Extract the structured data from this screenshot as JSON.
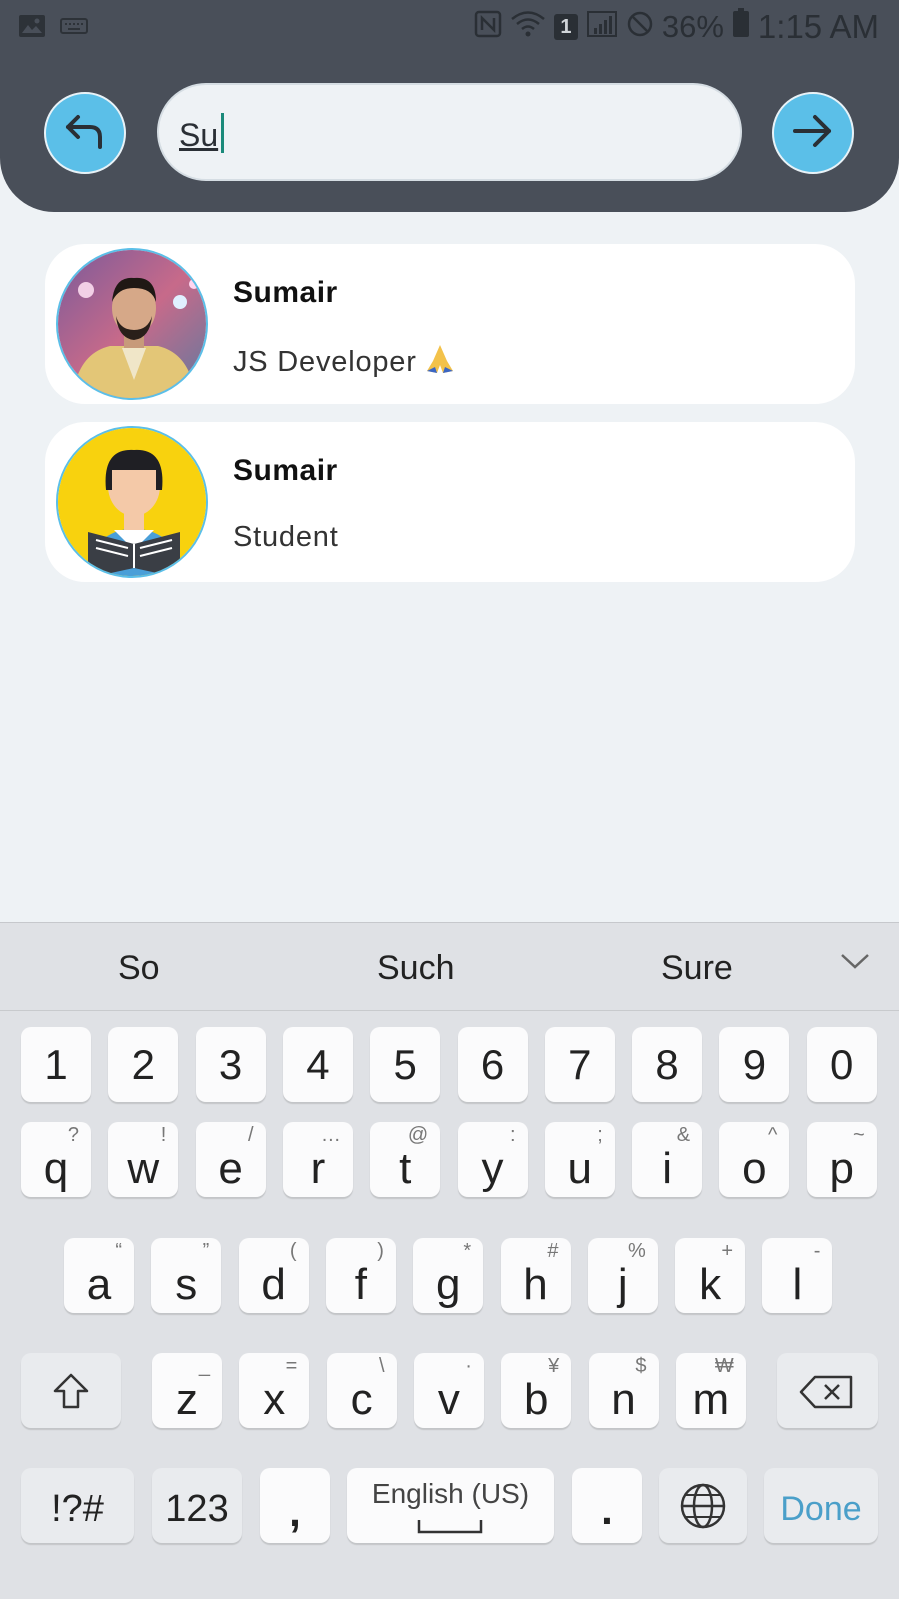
{
  "status_bar": {
    "battery_percent": "36%",
    "time": "1:15 AM",
    "sim_badge": "1",
    "icons": [
      "image-icon",
      "keyboard-icon",
      "nfc-icon",
      "wifi-icon",
      "signal-icon",
      "do-not-disturb-icon",
      "battery-icon"
    ]
  },
  "search": {
    "value": "Su",
    "back_icon": "back-arrow-icon",
    "go_icon": "arrow-right-icon"
  },
  "results": [
    {
      "name": "Sumair",
      "subtitle": "JS Developer",
      "emoji": "folded-hands-emoji",
      "avatar": "photo"
    },
    {
      "name": "Sumair",
      "subtitle": "Student",
      "avatar": "student-illustration"
    }
  ],
  "keyboard": {
    "suggestions": [
      "So",
      "Such",
      "Sure"
    ],
    "numbers": [
      "1",
      "2",
      "3",
      "4",
      "5",
      "6",
      "7",
      "8",
      "9",
      "0"
    ],
    "row1": [
      [
        "q",
        "?"
      ],
      [
        "w",
        "!"
      ],
      [
        "e",
        "/"
      ],
      [
        "r",
        "…"
      ],
      [
        "t",
        "@"
      ],
      [
        "y",
        ":"
      ],
      [
        "u",
        ";"
      ],
      [
        "i",
        "&"
      ],
      [
        "o",
        "^"
      ],
      [
        "p",
        "~"
      ]
    ],
    "row2": [
      [
        "a",
        "“"
      ],
      [
        "s",
        "”"
      ],
      [
        "d",
        "("
      ],
      [
        "f",
        ")"
      ],
      [
        "g",
        "*"
      ],
      [
        "h",
        "#"
      ],
      [
        "j",
        "%"
      ],
      [
        "k",
        "+"
      ],
      [
        "l",
        "-"
      ]
    ],
    "row3": [
      [
        "z",
        "_"
      ],
      [
        "x",
        "="
      ],
      [
        "c",
        "\\"
      ],
      [
        "v",
        "·"
      ],
      [
        "b",
        "¥"
      ],
      [
        "n",
        "$"
      ],
      [
        "m",
        "₩"
      ]
    ],
    "symbols_label": "!?#",
    "numbers_label": "123",
    "comma": ",",
    "space_label": "English (US)",
    "period": ".",
    "done_label": "Done",
    "accent": "#4a9fc9"
  },
  "colors": {
    "header": "#494f59",
    "button": "#5bbfe8",
    "background": "#eef2f5"
  }
}
